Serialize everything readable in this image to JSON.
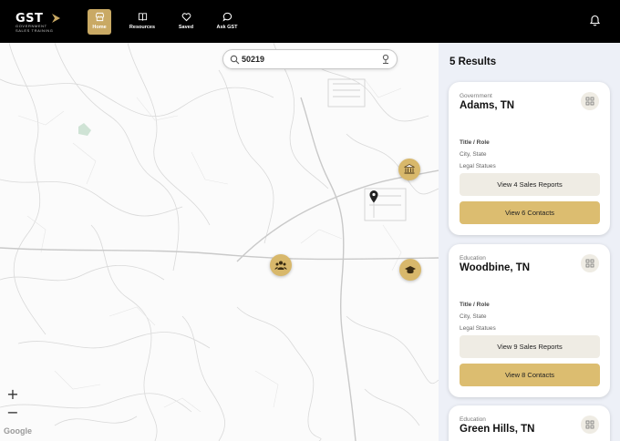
{
  "nav": {
    "logo_text": "GST",
    "logo_sub": "GOVERNMENT SALES TRAINING",
    "items": [
      {
        "label": "Home",
        "icon": "store-icon"
      },
      {
        "label": "Resources",
        "icon": "book-icon"
      },
      {
        "label": "Saved",
        "icon": "heart-icon"
      },
      {
        "label": "Ask GST",
        "icon": "chat-bubble-icon"
      }
    ],
    "notification_icon": "bell-icon"
  },
  "map": {
    "search_value": "50219",
    "zoom_in": "+",
    "zoom_out": "−",
    "attribution": "Google",
    "markers": [
      "bank-icon",
      "graduation-cap-icon",
      "people-icon",
      "location-pin-icon"
    ]
  },
  "results": {
    "title": "5 Results",
    "cards": [
      {
        "category": "Government",
        "name": "Adams, TN",
        "role": "Title / Role",
        "city": "City, State",
        "legal": "Legal Statues",
        "sales_button": "View 4 Sales Reports",
        "contacts_button": "View 6 Contacts"
      },
      {
        "category": "Education",
        "name": "Woodbine, TN",
        "role": "Title / Role",
        "city": "City, State",
        "legal": "Legal Statues",
        "sales_button": "View 9 Sales Reports",
        "contacts_button": "View 8 Contacts"
      },
      {
        "category": "Education",
        "name": "Green Hills, TN"
      }
    ]
  },
  "colors": {
    "accent_gold": "#d8b86b",
    "nav_bg": "#000000",
    "panel_bg": "#edf0f7"
  }
}
